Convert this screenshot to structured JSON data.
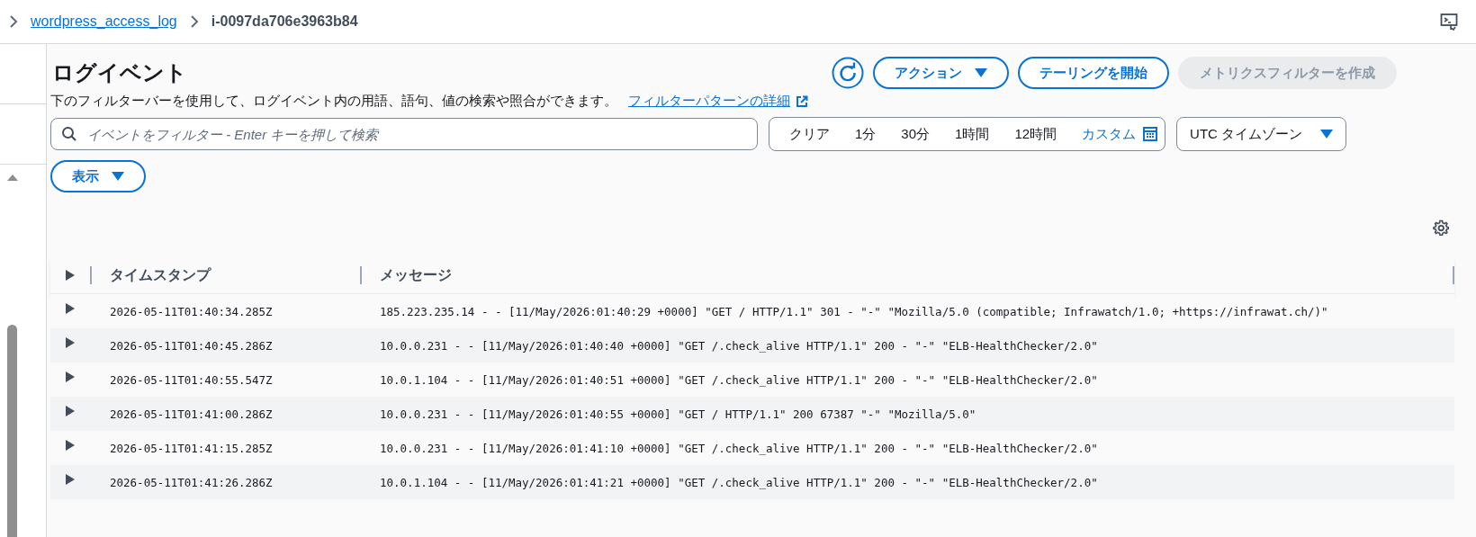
{
  "breadcrumb": [
    {
      "label": "wordpress_access_log",
      "kind": "link"
    },
    {
      "label": "i-0097da706e3963b84",
      "kind": "current"
    }
  ],
  "header": {
    "title": "ログイベント",
    "description": "下のフィルターバーを使用して、ログイベント内の用語、語句、値の検索や照合ができます。",
    "help_link": "フィルターパターンの詳細"
  },
  "actions": [
    {
      "label": "アクション",
      "kind": "dropdown",
      "disabled": false
    },
    {
      "label": "テーリングを開始",
      "kind": "button",
      "disabled": false
    },
    {
      "label": "メトリクスフィルターを作成",
      "kind": "button",
      "disabled": true
    }
  ],
  "search": {
    "placeholder": "イベントをフィルター - Enter キーを押して検索"
  },
  "time_range": [
    {
      "label": "クリア",
      "kind": "text"
    },
    {
      "label": "1分",
      "kind": "text"
    },
    {
      "label": "30分",
      "kind": "text"
    },
    {
      "label": "1時間",
      "kind": "text"
    },
    {
      "label": "12時間",
      "kind": "text"
    },
    {
      "label": "カスタム",
      "kind": "custom"
    }
  ],
  "timezone": {
    "label": "UTC タイムゾーン"
  },
  "display_button": {
    "label": "表示"
  },
  "table": {
    "columns": [
      "タイムスタンプ",
      "メッセージ"
    ],
    "rows": [
      {
        "timestamp": "2026-05-11T01:40:34.285Z",
        "message": "185.223.235.14 - - [11/May/2026:01:40:29 +0000] \"GET / HTTP/1.1\" 301 - \"-\" \"Mozilla/5.0 (compatible; Infrawatch/1.0; +https://infrawat.ch/)\""
      },
      {
        "timestamp": "2026-05-11T01:40:45.286Z",
        "message": "10.0.0.231 - - [11/May/2026:01:40:40 +0000] \"GET /.check_alive HTTP/1.1\" 200 - \"-\" \"ELB-HealthChecker/2.0\""
      },
      {
        "timestamp": "2026-05-11T01:40:55.547Z",
        "message": "10.0.1.104 - - [11/May/2026:01:40:51 +0000] \"GET /.check_alive HTTP/1.1\" 200 - \"-\" \"ELB-HealthChecker/2.0\""
      },
      {
        "timestamp": "2026-05-11T01:41:00.286Z",
        "message": "10.0.0.231 - - [11/May/2026:01:40:55 +0000] \"GET / HTTP/1.1\" 200 67387 \"-\" \"Mozilla/5.0\""
      },
      {
        "timestamp": "2026-05-11T01:41:15.285Z",
        "message": "10.0.0.231 - - [11/May/2026:01:41:10 +0000] \"GET /.check_alive HTTP/1.1\" 200 - \"-\" \"ELB-HealthChecker/2.0\""
      },
      {
        "timestamp": "2026-05-11T01:41:26.286Z",
        "message": "10.0.1.104 - - [11/May/2026:01:41:21 +0000] \"GET /.check_alive HTTP/1.1\" 200 - \"-\" \"ELB-HealthChecker/2.0\""
      }
    ]
  }
}
